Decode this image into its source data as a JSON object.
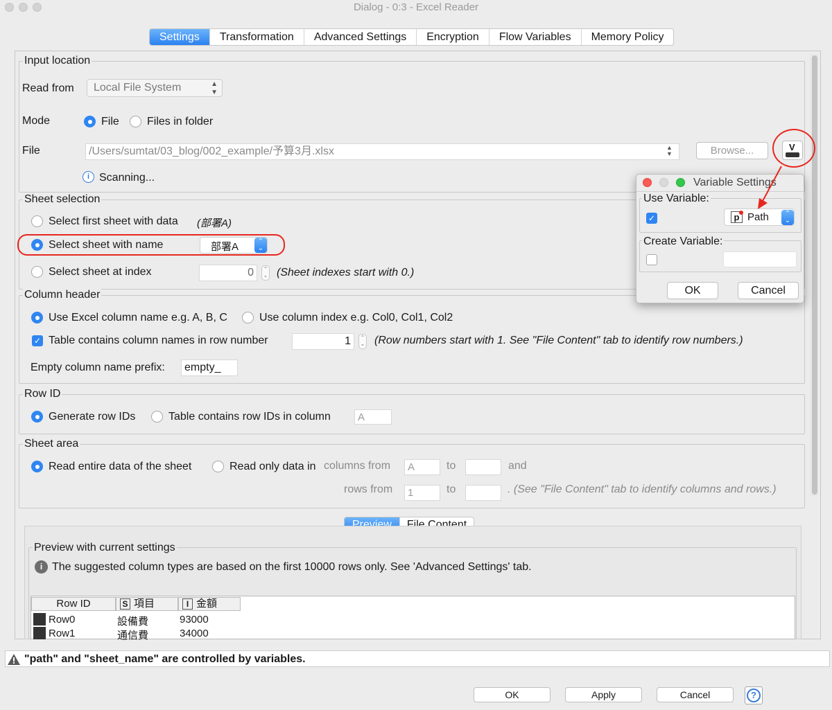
{
  "window": {
    "title": "Dialog - 0:3 - Excel Reader"
  },
  "tabs": [
    "Settings",
    "Transformation",
    "Advanced Settings",
    "Encryption",
    "Flow Variables",
    "Memory Policy"
  ],
  "input_location": {
    "title": "Input location",
    "read_from_label": "Read from",
    "read_from_value": "Local File System",
    "mode_label": "Mode",
    "mode_file": "File",
    "mode_folder": "Files in folder",
    "file_label": "File",
    "file_path": "/Users/sumtat/03_blog/002_example/予算3月.xlsx",
    "browse_label": "Browse...",
    "scanning": "Scanning..."
  },
  "sheet_selection": {
    "title": "Sheet selection",
    "first_sheet": "Select first sheet with data",
    "first_sheet_hint": "(部署A)",
    "by_name": "Select sheet with name",
    "sheet_name": "部署A",
    "by_index": "Select sheet at index",
    "index_value": "0",
    "index_hint": "(Sheet indexes start with 0.)"
  },
  "column_header": {
    "title": "Column header",
    "use_excel_name": "Use Excel column name e.g. A, B, C",
    "use_index": "Use column index e.g. Col0, Col1, Col2",
    "contains_names": "Table contains column names in row number",
    "row_number": "1",
    "row_hint": "(Row numbers start with 1. See \"File Content\" tab to identify row numbers.)",
    "prefix_label": "Empty column name prefix:",
    "prefix_value": "empty_"
  },
  "row_id": {
    "title": "Row ID",
    "generate": "Generate row IDs",
    "contains": "Table contains row IDs in column",
    "column": "A"
  },
  "sheet_area": {
    "title": "Sheet area",
    "entire": "Read entire data of the sheet",
    "only": "Read only data in",
    "columns_from": "columns from",
    "col_from": "A",
    "to1": "to",
    "and": "and",
    "rows_from": "rows from",
    "row_from": "1",
    "to2": "to",
    "hint": ". (See \"File Content\" tab to identify columns and rows.)"
  },
  "preview": {
    "tabs": [
      "Preview",
      "File Content"
    ],
    "title": "Preview with current settings",
    "info": "The suggested column types are based on the first 10000 rows only. See 'Advanced Settings' tab.",
    "headers": [
      {
        "type": "",
        "name": "Row ID"
      },
      {
        "type": "S",
        "name": "項目"
      },
      {
        "type": "I",
        "name": "金額"
      }
    ],
    "rows": [
      {
        "id": "Row0",
        "item": "設備費",
        "amount": "93000"
      },
      {
        "id": "Row1",
        "item": "通信費",
        "amount": "34000"
      }
    ]
  },
  "warning": "\"path\" and \"sheet_name\" are controlled by variables.",
  "footer": {
    "ok": "OK",
    "apply": "Apply",
    "cancel": "Cancel"
  },
  "variable_dialog": {
    "title": "Variable Settings",
    "use_label": "Use Variable:",
    "variable": "Path",
    "create_label": "Create Variable:",
    "ok": "OK",
    "cancel": "Cancel"
  },
  "colors": {
    "accent": "#2f86f2",
    "highlight": "#e8271f"
  }
}
